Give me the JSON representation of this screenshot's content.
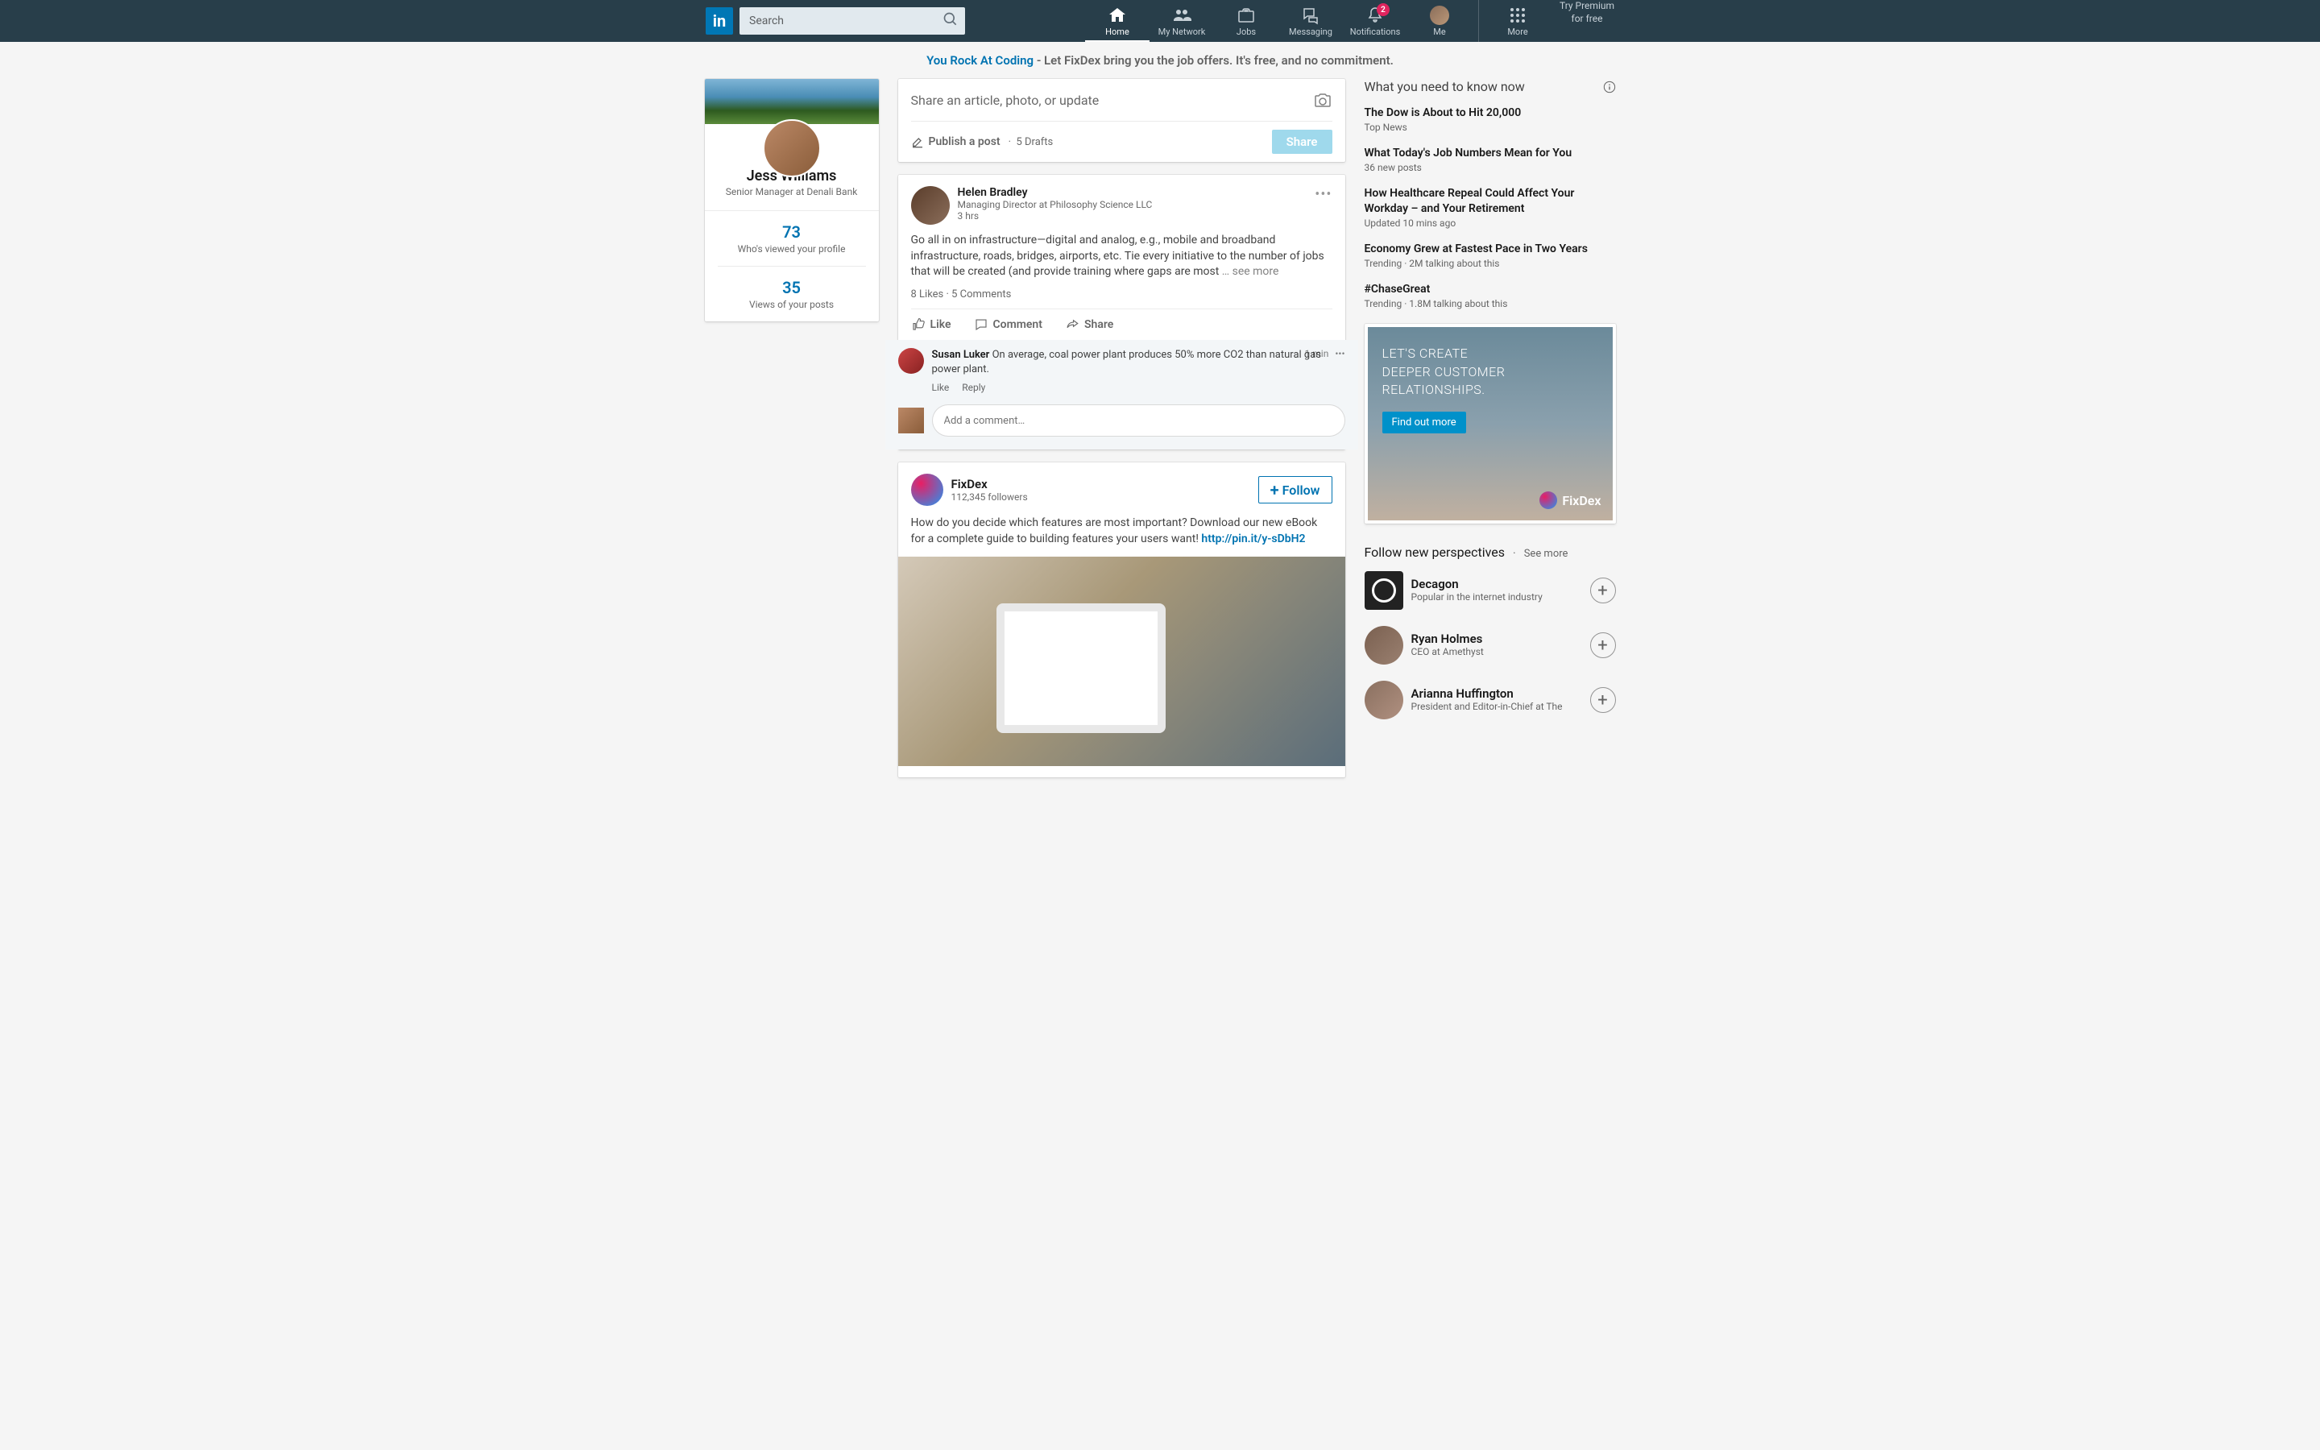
{
  "nav": {
    "search_placeholder": "Search",
    "items": [
      {
        "label": "Home"
      },
      {
        "label": "My Network"
      },
      {
        "label": "Jobs"
      },
      {
        "label": "Messaging"
      },
      {
        "label": "Notifications",
        "badge": "2"
      },
      {
        "label": "Me"
      }
    ],
    "more": "More",
    "premium_line1": "Try Premium",
    "premium_line2": "for free"
  },
  "promo": {
    "highlight": "You Rock At Coding",
    "rest": " - Let FixDex bring you the job offers. It's free, and no commitment."
  },
  "profile": {
    "name": "Jess Williams",
    "title": "Senior Manager at Denali Bank",
    "stat1_num": "73",
    "stat1_label": "Who's viewed your profile",
    "stat2_num": "35",
    "stat2_label": "Views of your posts"
  },
  "compose": {
    "prompt": "Share an article, photo, or update",
    "publish": "Publish a post",
    "drafts": "5 Drafts",
    "share": "Share"
  },
  "post1": {
    "author": "Helen Bradley",
    "headline": "Managing Director at Philosophy Science LLC",
    "time": "3 hrs",
    "body": "Go all in on infrastructure—digital and analog, e.g., mobile and broadband infrastructure, roads, bridges, airports, etc. Tie every initiative to the number of jobs that will be created (and provide training where gaps are most ",
    "see_more": "… see more",
    "stats": "8 Likes  ·  5 Comments",
    "like": "Like",
    "comment": "Comment",
    "share": "Share",
    "c1_author": "Susan Luker",
    "c1_text": "  On average, coal power plant produces 50% more CO2 than natural gas power plant.",
    "c1_time": "1 min",
    "c1_like": "Like",
    "c1_reply": "Reply",
    "comment_placeholder": "Add a comment…"
  },
  "post2": {
    "name": "FixDex",
    "sub": "112,345 followers",
    "follow": "Follow",
    "body": "How do you decide which features are most important? Download our new eBook for a complete guide to building features your users want! ",
    "link": "http://pin.it/y-sDbH2"
  },
  "news": {
    "title": "What you need to know now",
    "items": [
      {
        "headline": "The Dow is About to Hit 20,000",
        "meta": "Top News"
      },
      {
        "headline": "What Today's Job Numbers Mean for You",
        "meta": "36 new posts"
      },
      {
        "headline": "How Healthcare Repeal Could Affect Your Workday – and Your Retirement",
        "meta": "Updated 10 mins ago"
      },
      {
        "headline": "Economy Grew at Fastest Pace in Two Years",
        "meta": "Trending  ·  2M talking about this"
      },
      {
        "headline": "#ChaseGreat",
        "meta": "Trending  ·  1.8M talking about this"
      }
    ]
  },
  "ad": {
    "line1": "LET'S CREATE",
    "line2": "DEEPER CUSTOMER",
    "line3": "RELATIONSHIPS.",
    "cta": "Find out more",
    "brand": "FixDex"
  },
  "follow": {
    "title": "Follow new perspectives",
    "see": "See more",
    "items": [
      {
        "name": "Decagon",
        "sub": "Popular in the internet industry"
      },
      {
        "name": "Ryan Holmes",
        "sub": "CEO at Amethyst"
      },
      {
        "name": "Arianna Huffington",
        "sub": "President and Editor-in-Chief at The"
      }
    ]
  }
}
